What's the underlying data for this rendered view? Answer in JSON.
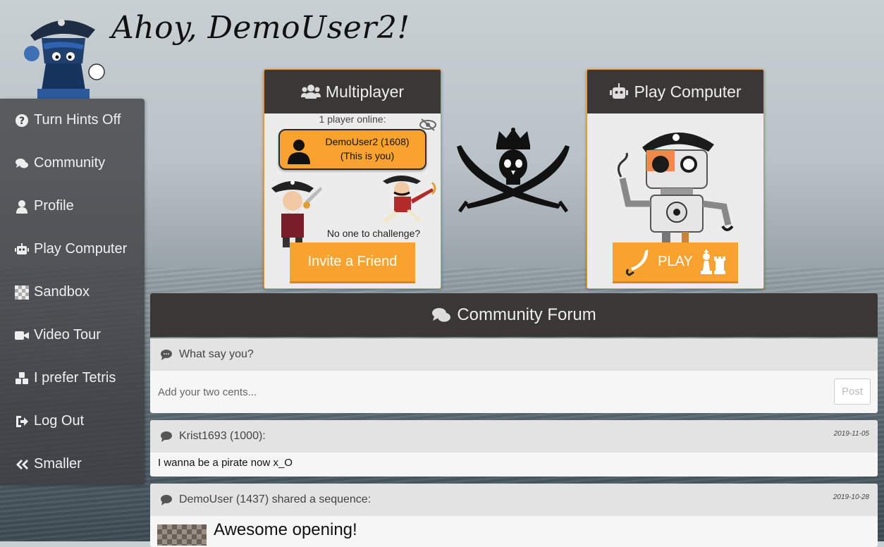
{
  "header": {
    "greeting": "Ahoy, DemoUser2!"
  },
  "sidebar": {
    "items": [
      {
        "label": "Turn Hints Off",
        "icon": "question-circle-icon"
      },
      {
        "label": "Community",
        "icon": "comments-icon"
      },
      {
        "label": "Profile",
        "icon": "user-icon"
      },
      {
        "label": "Play Computer",
        "icon": "robot-icon"
      },
      {
        "label": "Sandbox",
        "icon": "chessboard-icon"
      },
      {
        "label": "Video Tour",
        "icon": "video-icon"
      },
      {
        "label": "I prefer Tetris",
        "icon": "cubes-icon"
      },
      {
        "label": "Log Out",
        "icon": "sign-out-icon"
      },
      {
        "label": "Smaller",
        "icon": "double-chevron-left-icon"
      }
    ]
  },
  "multiplayer": {
    "title": "Multiplayer",
    "online_text": "1 player online:",
    "player_name": "DemoUser2 (1608)",
    "player_note": "(This is you)",
    "challenge_text": "No one to challenge?",
    "invite_label": "Invite a Friend"
  },
  "computer": {
    "title": "Play Computer",
    "play_label": "PLAY"
  },
  "forum": {
    "title": "Community Forum",
    "prompt": "What say you?",
    "input_placeholder": "Add your two cents...",
    "post_label": "Post",
    "messages": [
      {
        "author": "Krist1693 (1000):",
        "date": "2019-11-05",
        "text": "I wanna be a pirate now x_O"
      },
      {
        "author": "DemoUser (1437) shared a sequence:",
        "date": "2019-10-28",
        "text": "Awesome opening!"
      }
    ]
  },
  "colors": {
    "accent": "#f9a230",
    "dark": "#3a3836",
    "sidebar": "#3c3e40"
  }
}
